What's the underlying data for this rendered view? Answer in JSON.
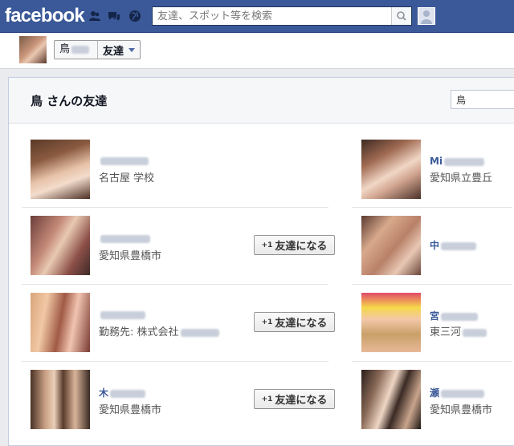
{
  "topbar": {
    "logo": "facebook",
    "search": {
      "placeholder": "友達、スポット等を検索",
      "value": ""
    }
  },
  "subheader": {
    "name": "鳥",
    "friends_label": "友達"
  },
  "panel": {
    "title": "鳥 さんの友達",
    "friend_search": "鳥"
  },
  "friends_left": [
    {
      "name": "",
      "info": "名古屋 学校",
      "button": null
    },
    {
      "name": "",
      "info": "愛知県豊橋市",
      "button": "友達になる"
    },
    {
      "name": "",
      "info": "勤務先: 株式会社",
      "button": "友達になる"
    },
    {
      "name": "木",
      "info": "愛知県豊橋市",
      "button": "友達になる"
    }
  ],
  "friends_right": [
    {
      "name": "Mi",
      "info": "愛知県立豊丘"
    },
    {
      "name": "中",
      "info": ""
    },
    {
      "name": "宮",
      "info": "東三河"
    },
    {
      "name": "瀬",
      "info": "愛知県豊橋市"
    }
  ],
  "add_button_badge": "+1"
}
